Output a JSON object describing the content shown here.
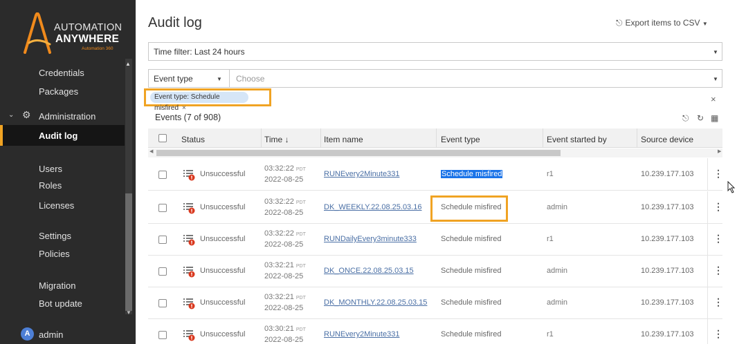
{
  "brand": {
    "line1": "AUTOMATION",
    "line2": "ANYWHERE",
    "line3": "Automation 360"
  },
  "sidebar": {
    "items_top": [
      "Credentials",
      "Packages"
    ],
    "section": "Administration",
    "active": "Audit log",
    "items_mid1": [
      "Users",
      "Roles",
      "Licenses"
    ],
    "items_mid2": [
      "Settings",
      "Policies"
    ],
    "items_mid3": [
      "Migration",
      "Bot update"
    ],
    "user_initial": "A",
    "user_name": "admin"
  },
  "page": {
    "title": "Audit log",
    "export_label": "Export items to CSV",
    "time_filter": "Time filter: Last 24 hours",
    "event_type_select": "Event type",
    "choose_placeholder": "Choose",
    "chip_label": "Event type: Schedule misfired",
    "events_count": "Events (7 of 908)"
  },
  "table": {
    "headers": [
      "Status",
      "Time",
      "Item name",
      "Event type",
      "Event started by",
      "Source device"
    ],
    "rows": [
      {
        "status": "Unsuccessful",
        "time": "03:32:22",
        "tz": "PDT",
        "date": "2022-08-25",
        "item": "RUNEvery2Minute331",
        "event": "Schedule misfired",
        "by": "r1",
        "device": "10.239.177.103"
      },
      {
        "status": "Unsuccessful",
        "time": "03:32:22",
        "tz": "PDT",
        "date": "2022-08-25",
        "item": "DK_WEEKLY.22.08.25.03.16",
        "event": "Schedule misfired",
        "by": "admin",
        "device": "10.239.177.103"
      },
      {
        "status": "Unsuccessful",
        "time": "03:32:22",
        "tz": "PDT",
        "date": "2022-08-25",
        "item": "RUNDailyEvery3minute333",
        "event": "Schedule misfired",
        "by": "r1",
        "device": "10.239.177.103"
      },
      {
        "status": "Unsuccessful",
        "time": "03:32:21",
        "tz": "PDT",
        "date": "2022-08-25",
        "item": "DK_ONCE.22.08.25.03.15",
        "event": "Schedule misfired",
        "by": "admin",
        "device": "10.239.177.103"
      },
      {
        "status": "Unsuccessful",
        "time": "03:32:21",
        "tz": "PDT",
        "date": "2022-08-25",
        "item": "DK_MONTHLY.22.08.25.03.15",
        "event": "Schedule misfired",
        "by": "admin",
        "device": "10.239.177.103"
      },
      {
        "status": "Unsuccessful",
        "time": "03:30:21",
        "tz": "PDT",
        "date": "2022-08-25",
        "item": "RUNEvery2Minute331",
        "event": "Schedule misfired",
        "by": "r1",
        "device": "10.239.177.103"
      }
    ]
  },
  "colors": {
    "accent": "#f0a323",
    "sidebar_bg": "#2b2b2b",
    "link": "#4a6fa5",
    "chip_bg": "#d6e6f7",
    "status_red": "#d9381e"
  }
}
